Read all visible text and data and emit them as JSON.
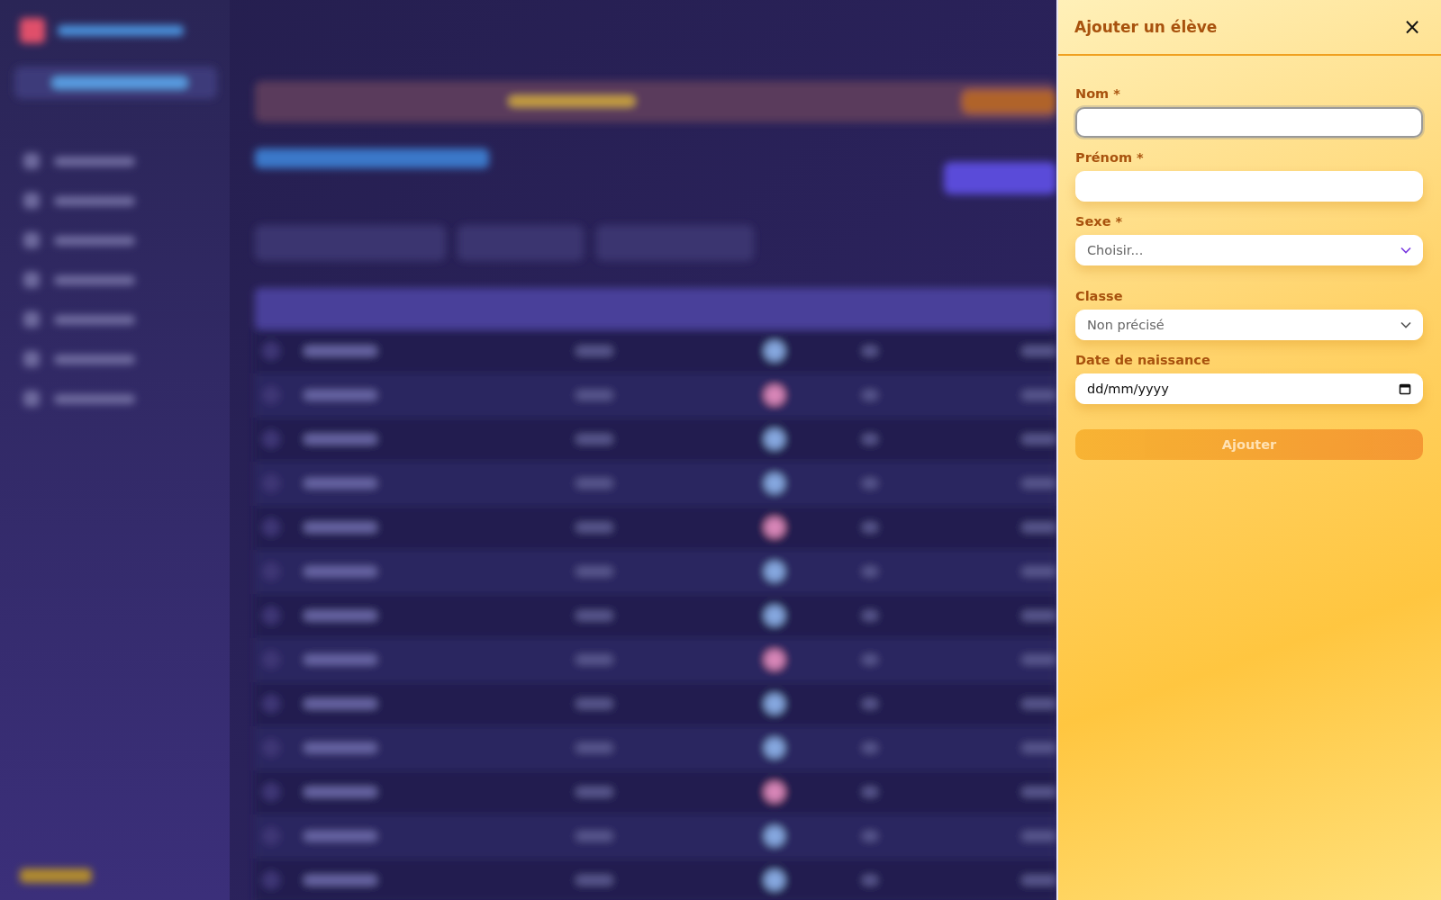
{
  "panel": {
    "title": "Ajouter un élève",
    "close": "×",
    "fields": [
      {
        "kind": "text",
        "label": "Nom *",
        "focused": true
      },
      {
        "kind": "text",
        "label": "Prénom *",
        "focused": false
      },
      {
        "kind": "select",
        "label": "Sexe *",
        "value": "Choisir...",
        "focused": false
      },
      {
        "kind": "select",
        "label": "Classe",
        "value": "Non précisé",
        "focused": false
      },
      {
        "kind": "date",
        "label": "Date de naissance",
        "value": "dd/mm/yyyy",
        "focused": false
      }
    ],
    "submit": {
      "label": "Ajouter",
      "disabled": true
    }
  }
}
